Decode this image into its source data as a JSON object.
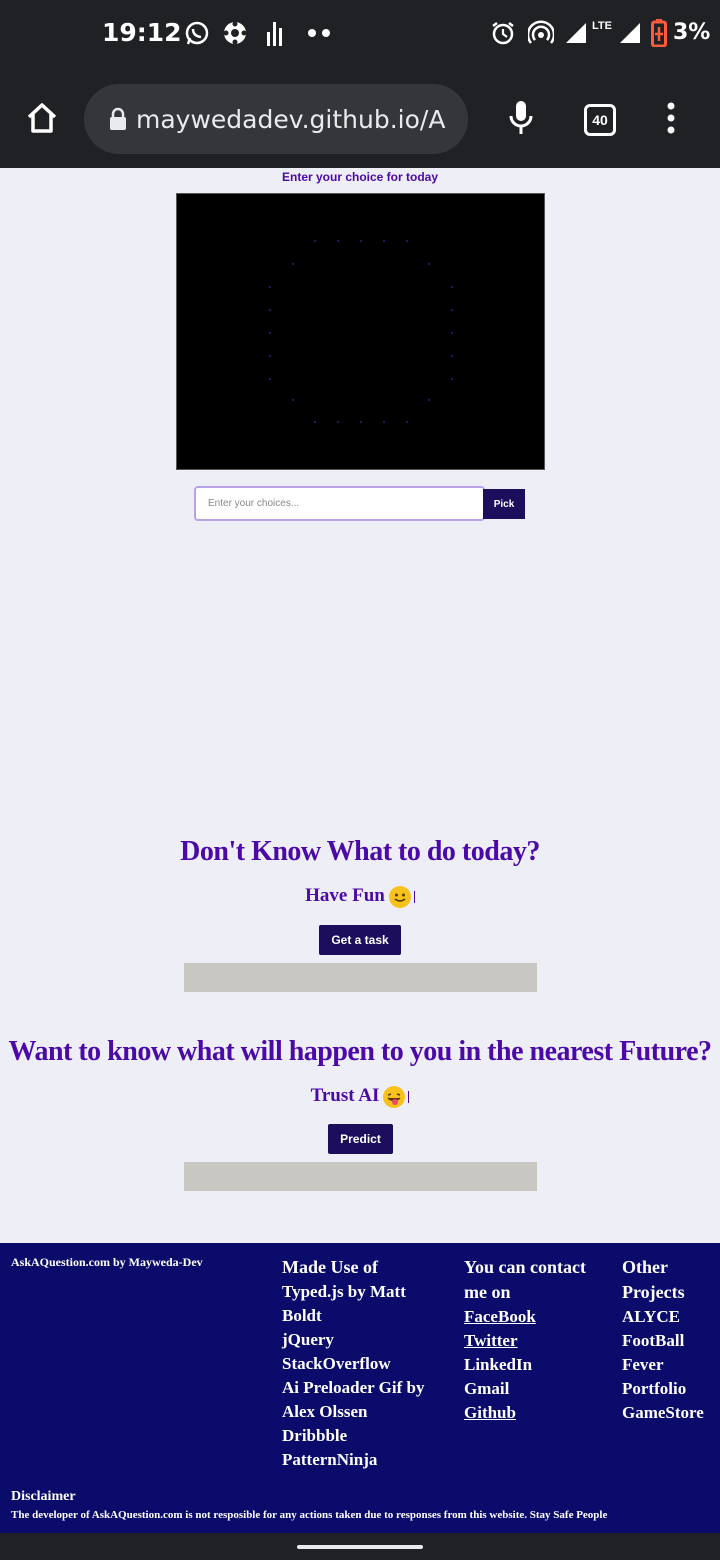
{
  "status_bar": {
    "time": "19:12",
    "network": "LTE",
    "battery": "3%",
    "icons": [
      "whatsapp-icon",
      "settings-app-icon",
      "bar-chart-icon",
      "more-dots-icon",
      "alarm-icon",
      "hotspot-icon",
      "signal-icon",
      "battery-icon"
    ]
  },
  "browser": {
    "url": "maywedadev.github.io/A",
    "tab_count": "40",
    "icons": [
      "home-icon",
      "lock-icon",
      "microphone-icon",
      "menu-icon"
    ]
  },
  "picker": {
    "title": "Enter your choice for today",
    "input_placeholder": "Enter your choices...",
    "pick_label": "Pick"
  },
  "task": {
    "title": "Don't Know What to do today?",
    "subtitle": "Have Fun",
    "button_label": "Get a task"
  },
  "future": {
    "title": "Want to know what will happen to you in the nearest Future?",
    "subtitle": "Trust AI",
    "button_label": "Predict"
  },
  "footer": {
    "brand": "AskAQuestion.com by Mayweda-Dev",
    "made_use_of": {
      "heading": "Made Use of",
      "items": [
        "Typed.js by Matt",
        "Boldt",
        "jQuery",
        "StackOverflow",
        "Ai Preloader Gif by",
        "Alex Olssen",
        "Dribbble",
        "PatternNinja"
      ]
    },
    "contact": {
      "heading_line1": "You can contact",
      "heading_line2": "me on",
      "items": [
        "FaceBook",
        "Twitter",
        "LinkedIn",
        "Gmail",
        "Github"
      ]
    },
    "projects": {
      "heading_line1": "Other",
      "heading_line2": "Projects",
      "items": [
        "ALYCE",
        "FootBall",
        "Fever",
        "Portfolio",
        "GameStore"
      ]
    },
    "disclaimer_title": "Disclaimer",
    "disclaimer_text": "The developer of AskAQuestion.com is not resposible for any actions taken due to responses from this website. Stay Safe People"
  },
  "colors": {
    "accent_purple": "#4b0aa8",
    "button_navy": "#1c0e5c",
    "footer_bg": "#0b0b6b",
    "page_bg": "#eeeef7"
  }
}
